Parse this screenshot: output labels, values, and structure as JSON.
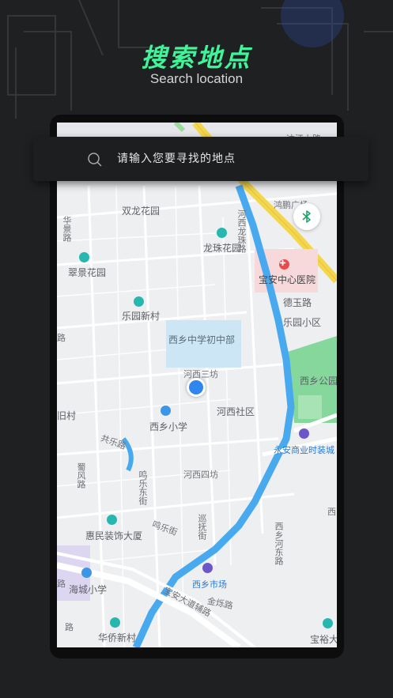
{
  "header": {
    "title": "搜索地点",
    "subtitle": "Search location"
  },
  "search": {
    "placeholder": "请输入您要寻找的地点"
  },
  "map": {
    "labels": {
      "shuanglong": "双龙花园",
      "longzhu_garden": "龙珠花园",
      "huaying_road": "华景路",
      "cuijing": "翠景花园",
      "leyuan_newvillage": "乐园新村",
      "hexi_longzhu_road": "河西龙珠路",
      "baoan_hospital": "宝安中心医院",
      "deyu_road": "德玉路",
      "leyuan_district": "乐园小区",
      "xixiang_middle": "西乡中学初中部",
      "hexi_sanfang": "河西三坊",
      "xixiang_park": "西乡公园",
      "jiu_village": "旧村",
      "hexi_community": "河西社区",
      "xixiang_primary": "西乡小学",
      "gongle_road": "共乐路",
      "yongan_mall": "永安商业时装城",
      "shufeng_road": "蜀风路",
      "mingle_street": "鸣乐东街",
      "hexi_sifang": "河西四坊",
      "xunfu_street": "巡抚街",
      "minle_street2": "鸣乐街",
      "huimin_building": "惠民装饰大厦",
      "xixiang_hedong": "西乡河东路",
      "haicheng_primary": "海城小学",
      "xixiang_market": "西乡市场",
      "baoan_aux_road": "宝安大道辅路",
      "jinshuo_road": "金烁路",
      "huaqiao": "华侨新村",
      "baoyu": "宝裕大",
      "xi_right": "西",
      "top_road": "达江上路",
      "top_jiang": "工",
      "hongpeng": "鸿鹏广场",
      "left_edge_road": "路",
      "left_edge_road2": "路",
      "left_edge_road3": "路"
    }
  },
  "colors": {
    "accent_green": "#3ff59a",
    "river_blue": "#49a9ee",
    "highway_yellow": "#f3d64e",
    "location_blue": "#2e86ee"
  },
  "icons": {
    "search": "search-icon",
    "bluetooth": "bluetooth-icon",
    "location": "current-location-icon"
  }
}
